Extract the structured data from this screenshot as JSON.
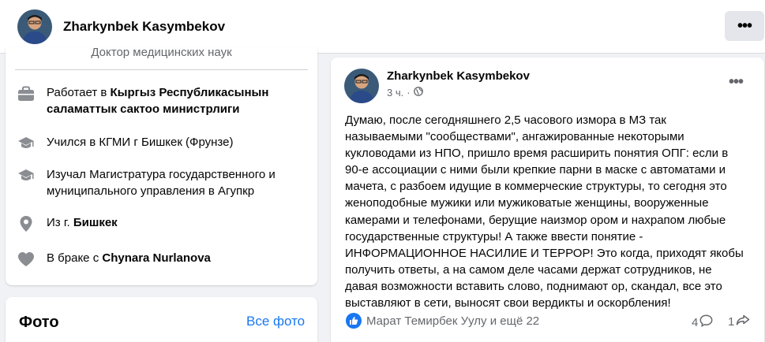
{
  "header": {
    "profile_name": "Zharkynbek Kasymbekov",
    "more_label": "•••"
  },
  "intro": {
    "top_partial": "Доктор медицинских наук",
    "items": [
      {
        "icon": "briefcase-icon",
        "prefix": "Работает в ",
        "bold": "Кыргыз Республикасынын саламаттык сактоо министрлиги"
      },
      {
        "icon": "graduation-cap-icon",
        "prefix": "Учился в КГМИ г Бишкек (Фрунзе)",
        "bold": ""
      },
      {
        "icon": "graduation-cap-icon",
        "prefix": "Изучал Магистратура государственного и муниципального управления в Агупкр",
        "bold": ""
      },
      {
        "icon": "location-pin-icon",
        "prefix": "Из г. ",
        "bold": "Бишкек"
      },
      {
        "icon": "heart-icon",
        "prefix": "В браке с ",
        "bold": "Chynara Nurlanova"
      }
    ]
  },
  "photos": {
    "title": "Фото",
    "all_link": "Все фото"
  },
  "post": {
    "author": "Zharkynbek Kasymbekov",
    "time": "3 ч.",
    "dot": "·",
    "privacy_icon": "globe-icon",
    "more_label": "•••",
    "text": "Думаю, после сегодняшнего 2,5 часового измора в МЗ так\nназываемыми \"сообществами\", ангажированные некоторыми\nкукловодами из НПО, пришло время расширить понятия ОПГ: если в\n90-е ассоциации с ними были крепкие парни в маске с автоматами и\nмачета, с разбоем идущие в коммерческие структуры, то сегодня это\nженоподобные мужики или мужиковатые женщины, вооруженные\nкамерами и телефонами, берущие наизмор ором и нахрапом любые\nгосударственные структуры! А также ввести понятие -\nИНФОРМАЦИОННОЕ НАСИЛИЕ И ТЕРРОР! Это когда, приходят якобы\nполучить ответы,  а на самом деле часами держат сотрудников, не\nдавая возможности вставить слово, поднимают ор, скандал, все это\nвыставляют в сети, выносят свои вердикты и оскорбления!",
    "reactions_text": "Марат Темирбек Уулу и ещё 22",
    "comments_count": "4",
    "shares_count": "1"
  },
  "colors": {
    "accent": "#1877f2",
    "secondary_text": "#65676b",
    "background": "#f0f2f5",
    "icon_gray": "#8a8d91"
  }
}
